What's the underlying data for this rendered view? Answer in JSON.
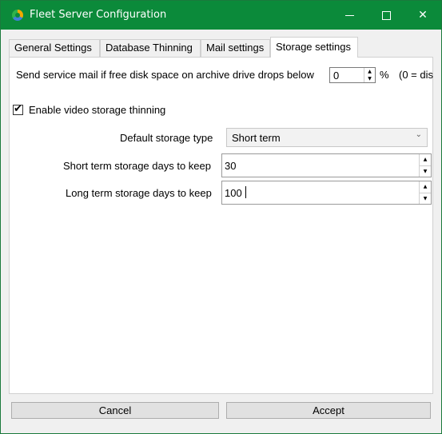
{
  "window": {
    "title": "Fleet Server Configuration",
    "controls": {
      "minimize": "minimize-icon",
      "maximize": "maximize-icon",
      "close": "close-icon",
      "close_glyph": "✕"
    }
  },
  "tabs": [
    {
      "label": "General Settings",
      "active": false
    },
    {
      "label": "Database Thinning",
      "active": false
    },
    {
      "label": "Mail settings",
      "active": false
    },
    {
      "label": "Storage settings",
      "active": true
    }
  ],
  "storage": {
    "service_mail_label": "Send service mail if free disk space on archive drive drops below",
    "service_mail_value": "0",
    "percent_label": "%",
    "disable_hint": "(0 = dis",
    "enable_thinning_label": "Enable video storage thinning",
    "enable_thinning_checked": true,
    "default_storage_type_label": "Default storage type",
    "default_storage_type_value": "Short term",
    "short_term_days_label": "Short term storage days to keep",
    "short_term_days_value": "30",
    "long_term_days_label": "Long term storage days to keep",
    "long_term_days_value": "100"
  },
  "buttons": {
    "cancel": "Cancel",
    "accept": "Accept"
  },
  "colors": {
    "titlebar": "#0b8a3a",
    "panel": "#ffffff",
    "window_bg": "#f0f0f0"
  }
}
